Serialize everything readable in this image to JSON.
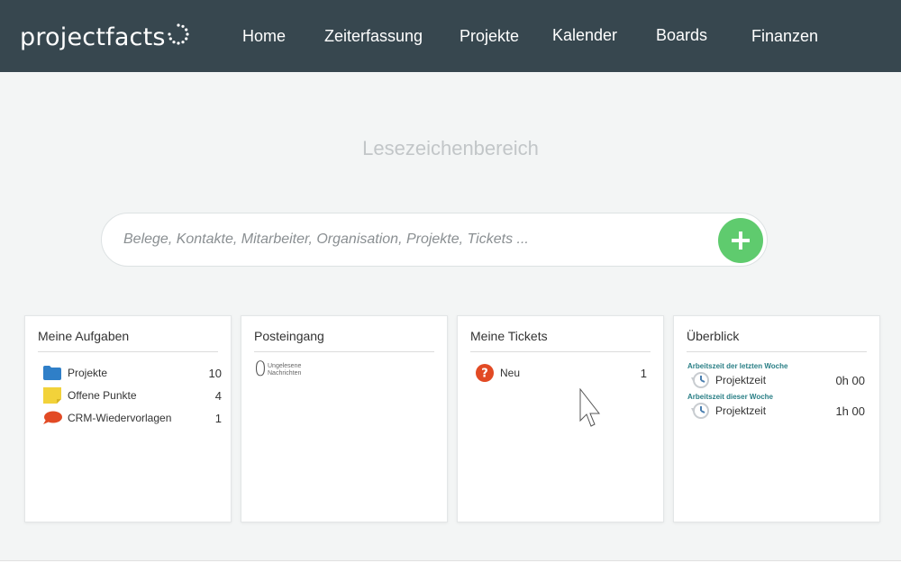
{
  "app": {
    "logo_text": "projectfacts",
    "logo_icon": "dotted-circle-icon"
  },
  "nav": {
    "items": [
      {
        "label": "Home"
      },
      {
        "label": "Zeiterfassung"
      },
      {
        "label": "Projekte"
      },
      {
        "label": "Kalender"
      },
      {
        "label": "Boards"
      },
      {
        "label": "Finanzen"
      }
    ]
  },
  "bookmarks": {
    "label": "Lesezeichenbereich"
  },
  "search": {
    "placeholder": "Belege, Kontakte, Mitarbeiter, Organisation, Projekte, Tickets ...",
    "value": "",
    "add_icon": "plus-icon"
  },
  "cards": {
    "tasks": {
      "title": "Meine Aufgaben",
      "items": [
        {
          "label": "Projekte",
          "count": "10",
          "icon": "folder-icon"
        },
        {
          "label": "Offene Punkte",
          "count": "4",
          "icon": "sticky-note-icon"
        },
        {
          "label": "CRM-Wiedervorlagen",
          "count": "1",
          "icon": "speech-bubble-icon"
        }
      ]
    },
    "inbox": {
      "title": "Posteingang",
      "count": "0",
      "label_line1": "Ungelesene",
      "label_line2": "Nachrichten"
    },
    "tickets": {
      "title": "Meine Tickets",
      "items": [
        {
          "label": "Neu",
          "count": "1",
          "icon": "question-icon"
        }
      ]
    },
    "overview": {
      "title": "Überblick",
      "sections": [
        {
          "heading": "Arbeitszeit der letzten Woche",
          "label": "Projektzeit",
          "value": "0h 00",
          "icon": "history-clock-icon"
        },
        {
          "heading": "Arbeitszeit dieser Woche",
          "label": "Projektzeit",
          "value": "1h 00",
          "icon": "history-clock-icon"
        }
      ]
    }
  },
  "colors": {
    "topbar": "#37474f",
    "accent_green": "#5fcb6e",
    "folder_blue": "#2f7fc8",
    "note_yellow": "#f2d23a",
    "bubble_red": "#e24a24",
    "question_red": "#e24a24",
    "overview_teal": "#2a7f86"
  }
}
